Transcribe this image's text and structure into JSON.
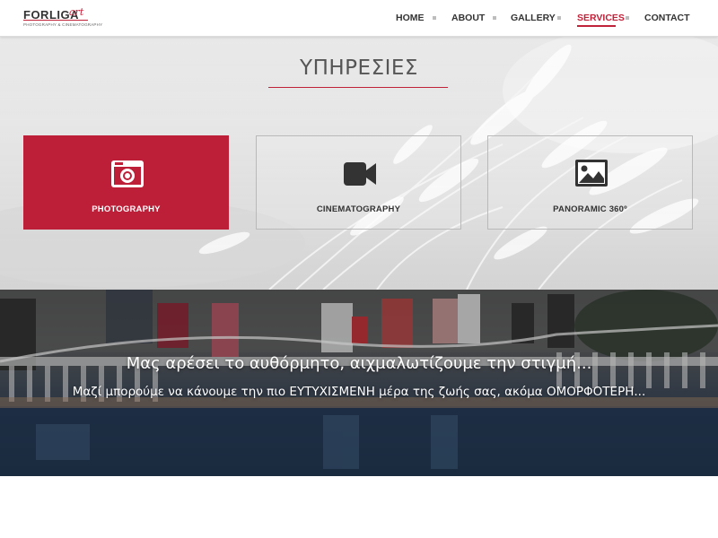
{
  "header": {
    "logo": {
      "main": "FORLIGA",
      "script": "art",
      "tagline": "PHOTOGRAPHY & CINEMATOGRAPHY"
    },
    "nav": [
      {
        "label": "HOME",
        "active": false
      },
      {
        "label": "ABOUT",
        "active": false
      },
      {
        "label": "GALLERY",
        "active": false
      },
      {
        "label": "SERVICES",
        "active": true
      },
      {
        "label": "CONTACT",
        "active": false
      }
    ]
  },
  "services": {
    "title": "ΥΠΗΡΕΣΙΕΣ",
    "cards": [
      {
        "label": "PHOTOGRAPHY",
        "icon": "camera-icon",
        "active": true
      },
      {
        "label": "CINEMATOGRAPHY",
        "icon": "video-camera-icon",
        "active": false
      },
      {
        "label": "PANORAMIC 360º",
        "icon": "image-icon",
        "active": false
      }
    ]
  },
  "banner": {
    "line1": "Μας αρέσει το αυθόρμητο, αιχμαλωτίζουμε την στιγμή...",
    "line2": "Μαζί μπορούμε να κάνουμε την πιο ΕΥΤΥΧΙΣΜΕΝΗ μέρα της ζωής σας, ακόμα ΟΜΟΡΦΟΤΕΡΗ..."
  },
  "colors": {
    "accent": "#c0223a",
    "text": "#333333",
    "card_border": "#b9b9b9"
  }
}
